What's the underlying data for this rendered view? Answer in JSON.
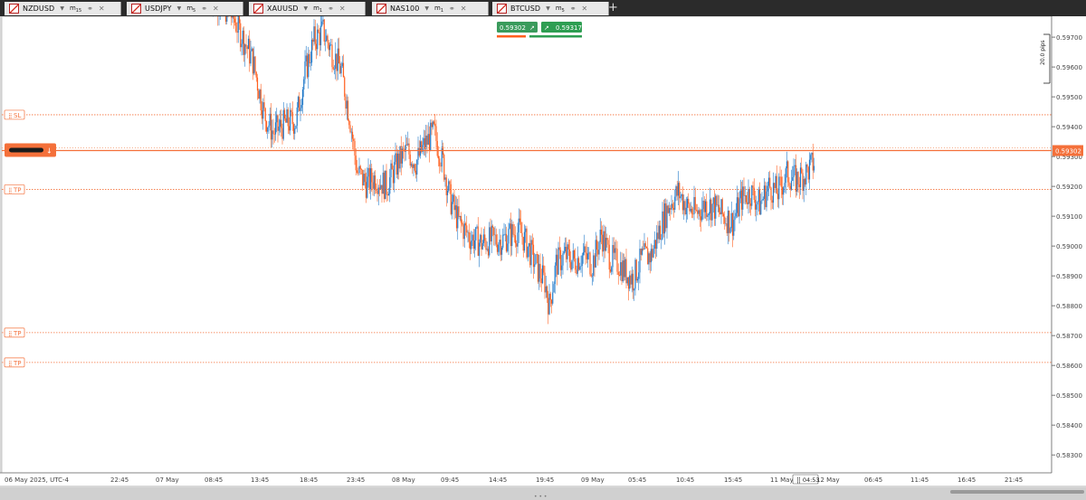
{
  "tabs": [
    {
      "symbol": "NZDUSD",
      "timeframe": "m",
      "timeframe_sub": "15"
    },
    {
      "symbol": "USDJPY",
      "timeframe": "m",
      "timeframe_sub": "5"
    },
    {
      "symbol": "XAUUSD",
      "timeframe": "m",
      "timeframe_sub": "1"
    },
    {
      "symbol": "NAS100",
      "timeframe": "m",
      "timeframe_sub": "1"
    },
    {
      "symbol": "BTCUSD",
      "timeframe": "m",
      "timeframe_sub": "5"
    }
  ],
  "quote": {
    "sell": "0.59302",
    "buy": "0.59317"
  },
  "ruler_label": "20.0 pips",
  "order_labels": {
    "sl": "SL",
    "tp": "TP"
  },
  "countdown": "04:53",
  "colors": {
    "bull": "#1f78c8",
    "bear": "#ff5f1f",
    "order_line": "#f4703a",
    "sell": "#3a9b5c",
    "buy": "#2e9e52"
  },
  "chart_data": {
    "type": "candlestick",
    "ylim": [
      0.5824,
      0.5977
    ],
    "y_ticks": [
      "0.59700",
      "0.59600",
      "0.59500",
      "0.59400",
      "0.59300",
      "0.59200",
      "0.59100",
      "0.59000",
      "0.58900",
      "0.58800",
      "0.58700",
      "0.58600",
      "0.58500",
      "0.58400",
      "0.58300"
    ],
    "x_ticks": [
      "06 May 2025, UTC-4",
      "22:45",
      "07 May",
      "08:45",
      "13:45",
      "18:45",
      "23:45",
      "08 May",
      "09:45",
      "14:45",
      "19:45",
      "09 May",
      "05:45",
      "10:45",
      "15:45",
      "11 May",
      "12 May",
      "06:45",
      "11:45",
      "16:45",
      "21:45"
    ],
    "current_price": "0.59302",
    "order_lines": [
      {
        "label": "SL",
        "price": 0.5944
      },
      {
        "label": "TP",
        "price": 0.5919
      },
      {
        "label": "TP",
        "price": 0.5871
      },
      {
        "label": "TP",
        "price": 0.5861
      }
    ],
    "position_price": 0.5932,
    "close_path": [
      [
        0,
        0.5985
      ],
      [
        20,
        0.5977
      ],
      [
        30,
        0.5969
      ],
      [
        38,
        0.5962
      ],
      [
        48,
        0.5944
      ],
      [
        56,
        0.5938
      ],
      [
        66,
        0.5941
      ],
      [
        76,
        0.5942
      ],
      [
        84,
        0.5958
      ],
      [
        92,
        0.5969
      ],
      [
        100,
        0.5972
      ],
      [
        108,
        0.5965
      ],
      [
        116,
        0.5959
      ],
      [
        124,
        0.5942
      ],
      [
        130,
        0.5925
      ],
      [
        138,
        0.5921
      ],
      [
        146,
        0.5923
      ],
      [
        156,
        0.592
      ],
      [
        166,
        0.5928
      ],
      [
        174,
        0.5932
      ],
      [
        182,
        0.5928
      ],
      [
        190,
        0.5934
      ],
      [
        198,
        0.5938
      ],
      [
        206,
        0.5928
      ],
      [
        212,
        0.5916
      ],
      [
        220,
        0.5908
      ],
      [
        230,
        0.5903
      ],
      [
        240,
        0.5901
      ],
      [
        250,
        0.5902
      ],
      [
        258,
        0.5902
      ],
      [
        266,
        0.5904
      ],
      [
        274,
        0.5905
      ],
      [
        282,
        0.5899
      ],
      [
        290,
        0.5892
      ],
      [
        296,
        0.5888
      ],
      [
        300,
        0.588
      ],
      [
        306,
        0.5894
      ],
      [
        314,
        0.5897
      ],
      [
        322,
        0.5895
      ],
      [
        330,
        0.5897
      ],
      [
        338,
        0.5894
      ],
      [
        346,
        0.5904
      ],
      [
        354,
        0.5896
      ],
      [
        362,
        0.5894
      ],
      [
        368,
        0.5891
      ],
      [
        374,
        0.5889
      ],
      [
        382,
        0.5896
      ],
      [
        390,
        0.5897
      ],
      [
        398,
        0.5906
      ],
      [
        406,
        0.5914
      ],
      [
        414,
        0.5918
      ],
      [
        422,
        0.5913
      ],
      [
        430,
        0.5911
      ],
      [
        438,
        0.5914
      ],
      [
        446,
        0.5913
      ],
      [
        454,
        0.591
      ],
      [
        462,
        0.5908
      ],
      [
        470,
        0.5916
      ],
      [
        478,
        0.5918
      ],
      [
        486,
        0.5914
      ],
      [
        494,
        0.592
      ],
      [
        502,
        0.5918
      ],
      [
        510,
        0.5924
      ],
      [
        518,
        0.5922
      ],
      [
        526,
        0.5924
      ],
      [
        534,
        0.5928
      ]
    ]
  }
}
